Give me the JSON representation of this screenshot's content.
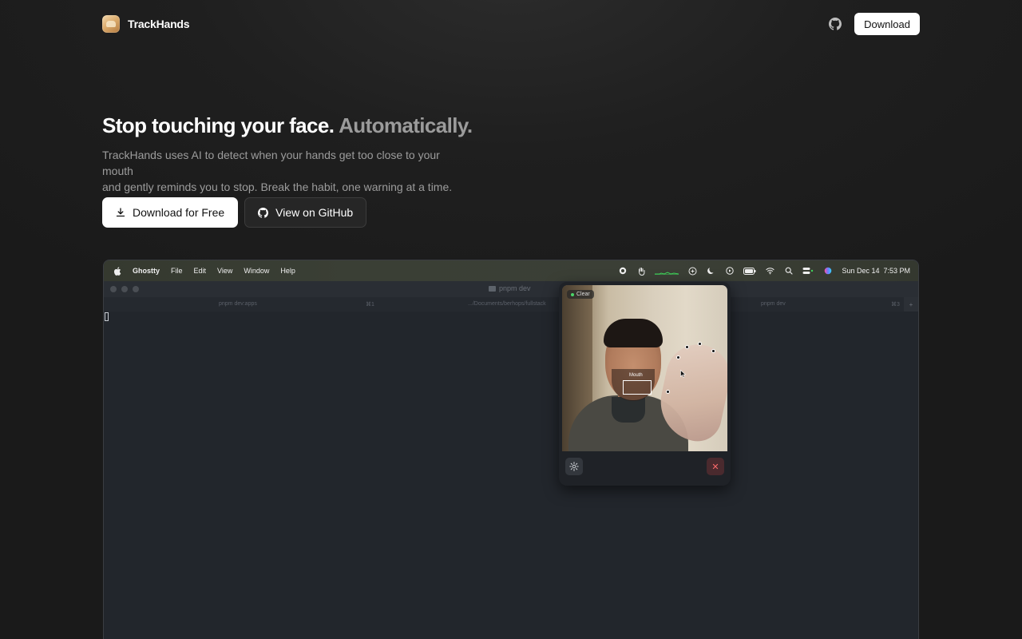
{
  "nav": {
    "brand": "TrackHands",
    "download_label": "Download"
  },
  "hero": {
    "headline_main": "Stop touching your face.",
    "headline_accent": "Automatically.",
    "sub_line1": "TrackHands uses AI to detect when your hands get too close to your mouth",
    "sub_line2": "and gently reminds you to stop. Break the habit, one warning at a time.",
    "primary_cta": "Download for Free",
    "secondary_cta": "View on GitHub"
  },
  "screenshot": {
    "menubar": {
      "app": "Ghostty",
      "menus": [
        "File",
        "Edit",
        "View",
        "Window",
        "Help"
      ],
      "clock": "Sun Dec 14  7:53 PM"
    },
    "terminal": {
      "title": "pnpm dev",
      "tabs": [
        {
          "label": "pnpm dev:apps",
          "shortcut": "⌘1"
        },
        {
          "label": ".../Documents/berhops/fullstack",
          "shortcut": ""
        },
        {
          "label": "pnpm dev",
          "shortcut": "⌘3"
        }
      ],
      "new_tab": "+"
    },
    "overlay": {
      "status": "Clear",
      "mouth_label": "Mouth",
      "close_glyph": "✕"
    }
  },
  "colors": {
    "status_ok": "#4bd66a",
    "close_red": "#ff6b6b",
    "accent_text": "#9b9b9b"
  }
}
